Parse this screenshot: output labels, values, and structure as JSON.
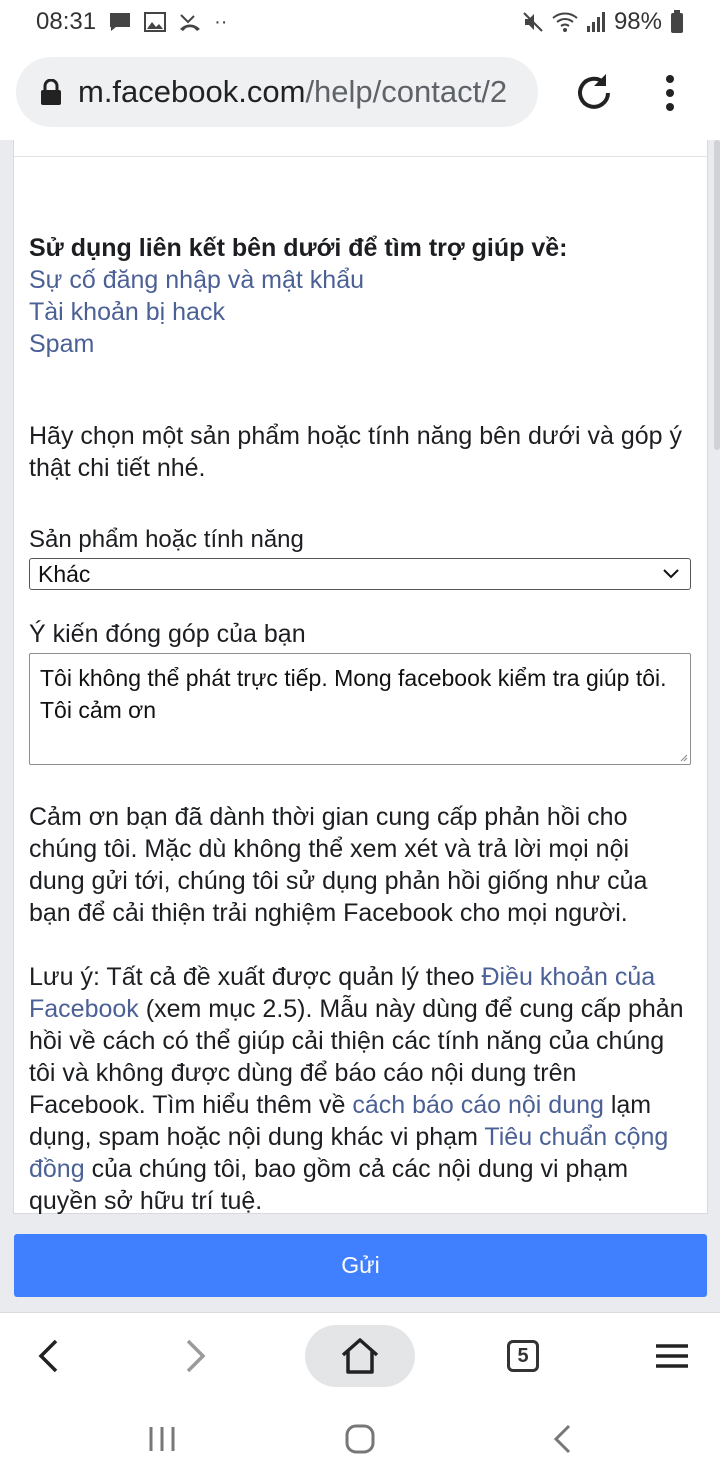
{
  "status_bar": {
    "time": "08:31",
    "more": "··",
    "battery": "98%"
  },
  "browser": {
    "url_domain": "m.facebook.com",
    "url_path": "/help/contact/2"
  },
  "form": {
    "help_heading": "Sử dụng liên kết bên dưới để tìm trợ giúp về:",
    "help_links": [
      "Sự cố đăng nhập và mật khẩu",
      "Tài khoản bị hack",
      "Spam"
    ],
    "intro": "Hãy chọn một sản phẩm hoặc tính năng bên dưới và góp ý thật chi tiết nhé.",
    "product_label": "Sản phẩm hoặc tính năng",
    "product_selected": "Khác",
    "feedback_label": "Ý kiến đóng góp của bạn",
    "feedback_value": "Tôi không thể phát trực tiếp. Mong facebook kiểm tra giúp tôi. Tôi cảm ơn",
    "thanks_text": "Cảm ơn bạn đã dành thời gian cung cấp phản hồi cho chúng tôi. Mặc dù không thể xem xét và trả lời mọi nội dung gửi tới, chúng tôi sử dụng phản hồi giống như của bạn để cải thiện trải nghiệm Facebook cho mọi người.",
    "note_part1": "Lưu ý: Tất cả đề xuất được quản lý theo ",
    "note_link1": "Điều khoản của Facebook",
    "note_part2": " (xem mục 2.5). Mẫu này dùng để cung cấp phản hồi về cách có thể giúp cải thiện các tính năng của chúng tôi và không được dùng để báo cáo nội dung trên Facebook. Tìm hiểu thêm về ",
    "note_link2": "cách báo cáo nội dung",
    "note_part3": " lạm dụng, spam hoặc nội dung khác vi phạm ",
    "note_link3": "Tiêu chuẩn cộng đồng",
    "note_part4": " của chúng tôi, bao gồm cả các nội dung vi phạm quyền sở hữu trí tuệ.",
    "submit_label": "Gửi"
  },
  "bottom_nav": {
    "tab_count": "5"
  },
  "colors": {
    "link": "#4b6196",
    "submit_bg": "#4080ff"
  }
}
